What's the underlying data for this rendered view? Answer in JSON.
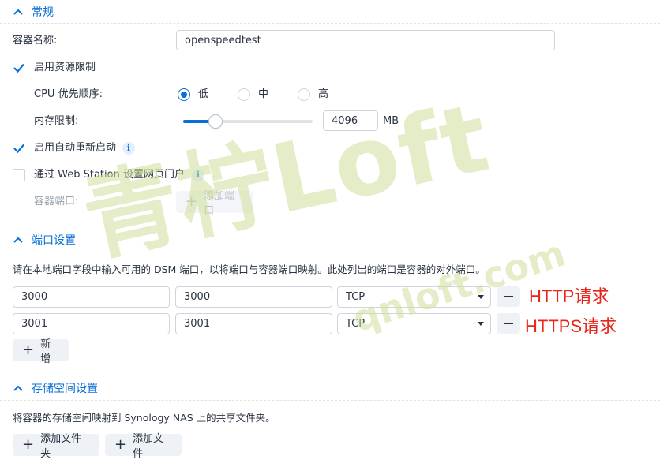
{
  "sections": {
    "general": "常规",
    "ports": "端口设置",
    "storage": "存储空间设置"
  },
  "general": {
    "container_name_label": "容器名称:",
    "container_name_value": "openspeedtest",
    "resource_limit_label": "启用资源限制",
    "cpu_priority_label": "CPU 优先顺序:",
    "cpu_options": [
      "低",
      "中",
      "高"
    ],
    "cpu_selected": "低",
    "memory_label": "内存限制:",
    "memory_value": "4096",
    "memory_unit": "MB",
    "memory_slider_fraction": 0.25,
    "auto_restart_label": "启用自动重新启动",
    "web_station_label": "通过 Web Station 设置网页门户",
    "container_port_label": "容器端口:",
    "add_port_label": "添加端口"
  },
  "ports": {
    "description": "请在本地端口字段中输入可用的 DSM 端口，以将端口与容器端口映射。此处列出的端口是容器的对外端口。",
    "rows": [
      {
        "local": "3000",
        "container": "3000",
        "protocol": "TCP",
        "annotation": "HTTP请求"
      },
      {
        "local": "3001",
        "container": "3001",
        "protocol": "TCP",
        "annotation": "HTTPS请求"
      }
    ],
    "add_label": "新增"
  },
  "storage": {
    "description": "将容器的存储空间映射到 Synology NAS 上的共享文件夹。",
    "add_folder_label": "添加文件夹",
    "add_file_label": "添加文件"
  },
  "watermark": {
    "text_main": "青柠Loft",
    "text_url": "qnloft.com"
  },
  "colors": {
    "accent": "#0a6fd6",
    "annotation": "#e8251a",
    "watermark": "#d6e6a8"
  }
}
